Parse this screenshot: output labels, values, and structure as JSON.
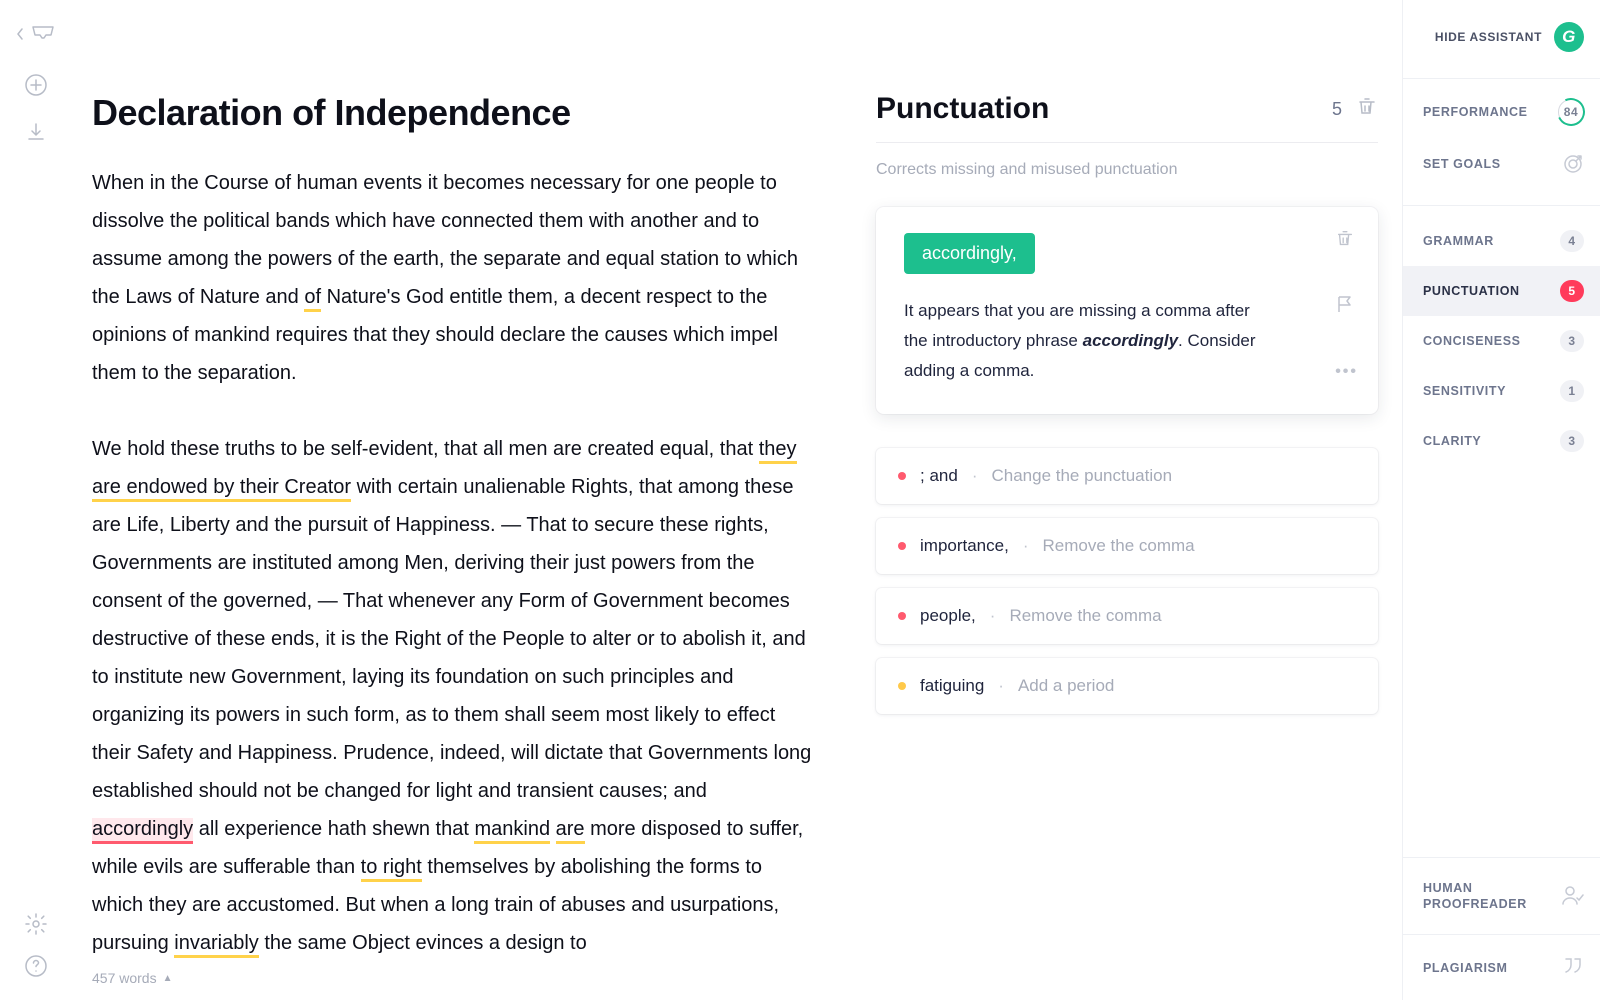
{
  "leftRail": {
    "inbox": "inbox",
    "add": "add",
    "download": "download",
    "settings": "settings",
    "help": "help"
  },
  "document": {
    "title": "Declaration of Independence",
    "para1_a": "When in the Course of human events it becomes necessary for one people to dissolve the political bands which have connected them with another and to assume among the powers of the earth, the separate and equal station to which the Laws of Nature and ",
    "para1_u1": "of",
    "para1_b": " Nature's God entitle them, a decent respect to the opinions of mankind requires that they should declare the causes which impel them to the separation.",
    "para2_a": "We hold these truths to be self-evident, that all men are created equal, that ",
    "para2_u1": "they are endowed by their Creator",
    "para2_b": " with certain unalienable Rights, that among these are Life, Liberty and the pursuit of Happiness. — That to secure these rights, Governments are instituted among Men, deriving their just powers from the consent of the governed, — That whenever any Form of Government becomes destructive of these ends, it is the Right of the People to alter or to abolish it, and to institute new Government, laying its foundation on such principles and organizing its powers in such form, as to them shall seem most likely to effect their Safety and Happiness. Prudence, indeed, will dictate that Governments long established should not be changed for light and transient causes; and ",
    "para2_err": "accordingly",
    "para2_c": " all experience hath shewn that ",
    "para2_u2": "mankind",
    "para2_sp": " ",
    "para2_u3": "are",
    "para2_d": " more disposed to suffer, while evils are sufferable than ",
    "para2_u4": "to right",
    "para2_e": " themselves by abolishing the forms to which they are accustomed. But when a long train of abuses and usurpations, pursuing ",
    "para2_u5": "invariably",
    "para2_f": " the same Object evinces a design to",
    "wordCount": "457 words"
  },
  "panel": {
    "title": "Punctuation",
    "count": "5",
    "desc": "Corrects missing and misused punctuation",
    "chip": "accordingly,",
    "explain_a": "It appears that you are missing a comma after the introductory phrase ",
    "explain_em": "accordingly",
    "explain_b": ". Consider adding a comma.",
    "rows": [
      {
        "dot": "red",
        "main": "; and",
        "hint": "Change the punctuation"
      },
      {
        "dot": "red",
        "main": "importance,",
        "hint": "Remove the comma"
      },
      {
        "dot": "red",
        "main": "people,",
        "hint": "Remove the comma"
      },
      {
        "dot": "yellow",
        "main": "fatiguing",
        "hint": "Add a period"
      }
    ]
  },
  "right": {
    "hide": "HIDE ASSISTANT",
    "perf": "PERFORMANCE",
    "perfScore": "84",
    "goals": "SET GOALS",
    "cats": [
      {
        "label": "GRAMMAR",
        "n": "4",
        "red": false
      },
      {
        "label": "PUNCTUATION",
        "n": "5",
        "red": true,
        "active": true
      },
      {
        "label": "CONCISENESS",
        "n": "3",
        "red": false
      },
      {
        "label": "SENSITIVITY",
        "n": "1",
        "red": false
      },
      {
        "label": "CLARITY",
        "n": "3",
        "red": false
      }
    ],
    "proof_l1": "HUMAN",
    "proof_l2": "PROOFREADER",
    "plag": "PLAGIARISM"
  }
}
